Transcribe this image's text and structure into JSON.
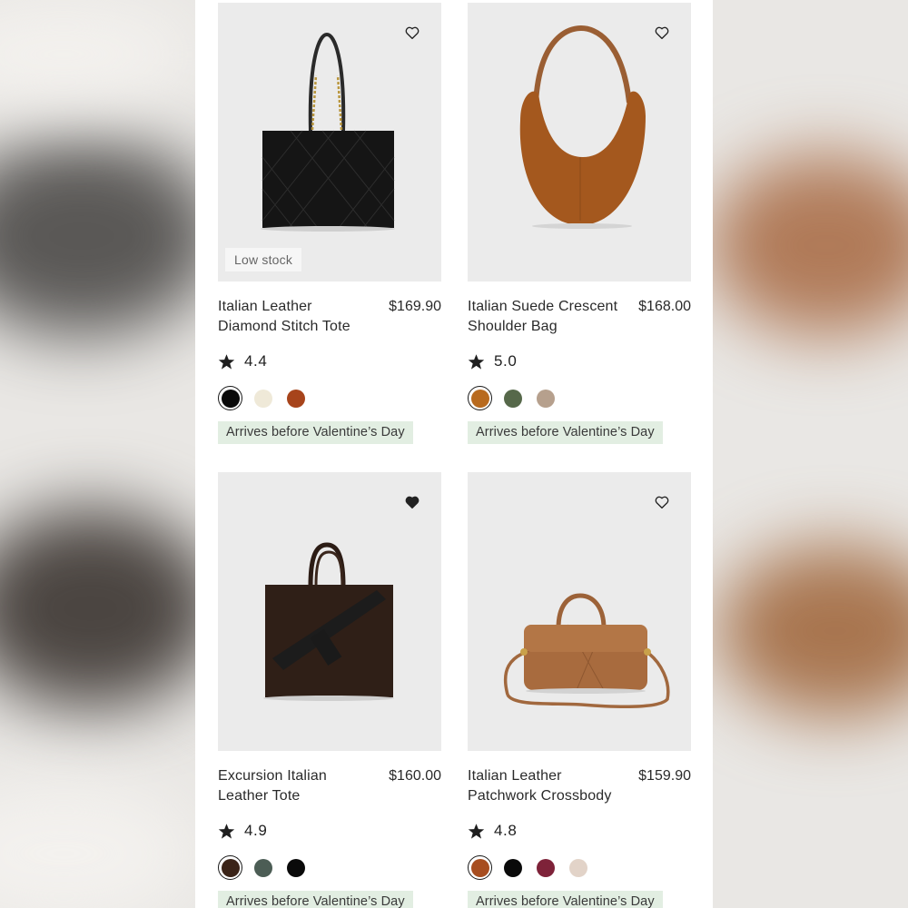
{
  "colors": {
    "panel_bg": "#ffffff",
    "image_bg": "#ebebeb",
    "badge_bg": "#e2eee2",
    "text": "#2a2a2a"
  },
  "products": [
    {
      "name": "Italian Leather Diamond Stitch Tote",
      "price": "$169.90",
      "rating": "4.4",
      "stock_label": "Low stock",
      "favorited": false,
      "swatches": [
        "#0a0a0a",
        "#efe9d8",
        "#a7441b"
      ],
      "selected_swatch": 0,
      "delivery": "Arrives before Valentine’s Day",
      "image_icon": "black-diamond-tote-image"
    },
    {
      "name": "Italian Suede Crescent Shoulder Bag",
      "price": "$168.00",
      "rating": "5.0",
      "favorited": false,
      "swatches": [
        "#b86a1e",
        "#56684a",
        "#b6a08d"
      ],
      "selected_swatch": 0,
      "delivery": "Arrives before Valentine’s Day",
      "image_icon": "suede-crescent-bag-image"
    },
    {
      "name": "Excursion Italian Leather Tote",
      "price": "$160.00",
      "rating": "4.9",
      "favorited": true,
      "swatches": [
        "#3b2418",
        "#4c5d55",
        "#0a0a0a"
      ],
      "selected_swatch": 0,
      "delivery": "Arrives before Valentine’s Day",
      "image_icon": "brown-excursion-tote-image"
    },
    {
      "name": "Italian Leather Patchwork Crossbody",
      "price": "$159.90",
      "rating": "4.8",
      "favorited": false,
      "swatches": [
        "#a74d1f",
        "#0a0a0a",
        "#7e2239",
        "#e2d3c8"
      ],
      "selected_swatch": 0,
      "delivery": "Arrives before Valentine’s Day",
      "image_icon": "patchwork-crossbody-image"
    }
  ]
}
